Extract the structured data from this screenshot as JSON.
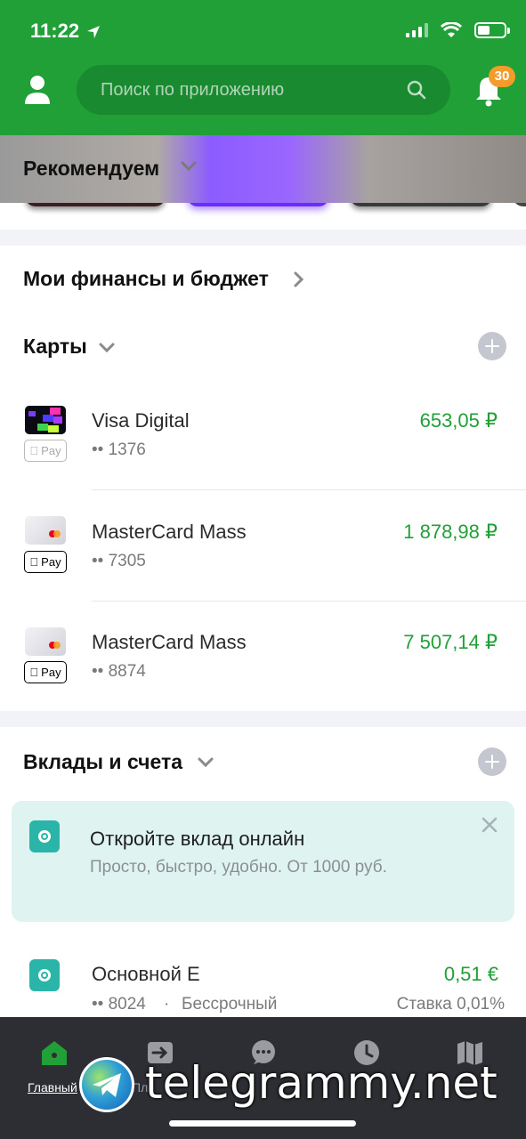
{
  "status": {
    "time": "11:22",
    "battery_level": 0.45
  },
  "header": {
    "search_placeholder": "Поиск по приложению",
    "notifications_count": "30",
    "accent": "#21a038"
  },
  "recommend": {
    "title": "Рекомендуем"
  },
  "finance": {
    "title": "Мои финансы и бюджет"
  },
  "cards": {
    "title": "Карты",
    "items": [
      {
        "name": "Visa Digital",
        "number": "•• 1376",
        "amount": "653,05 ₽",
        "pay_label": "Pay",
        "pay_active": false
      },
      {
        "name": "MasterCard Mass",
        "number": "•• 7305",
        "amount": "1 878,98 ₽",
        "pay_label": "Pay",
        "pay_active": true
      },
      {
        "name": "MasterCard Mass",
        "number": "•• 8874",
        "amount": "7 507,14 ₽",
        "pay_label": "Pay",
        "pay_active": true
      }
    ]
  },
  "deposits": {
    "title": "Вклады и счета",
    "promo": {
      "title": "Откройте вклад онлайн",
      "subtitle": "Просто, быстро, удобно. От 1000 руб."
    },
    "account": {
      "name": "Основной Е",
      "number": "•• 8024",
      "term": "Бессрочный",
      "separator": "·",
      "amount": "0,51 €",
      "rate": "Ставка 0,01%"
    }
  },
  "tabbar": {
    "items": [
      {
        "label": "Главный",
        "icon": "home-icon"
      },
      {
        "label": "Пл",
        "icon": "transfer-icon"
      },
      {
        "label": "",
        "icon": "chat-icon"
      },
      {
        "label": "",
        "icon": "history-icon"
      },
      {
        "label": "",
        "icon": "map-icon"
      }
    ]
  },
  "watermark": {
    "text": "telegrammy.net"
  }
}
